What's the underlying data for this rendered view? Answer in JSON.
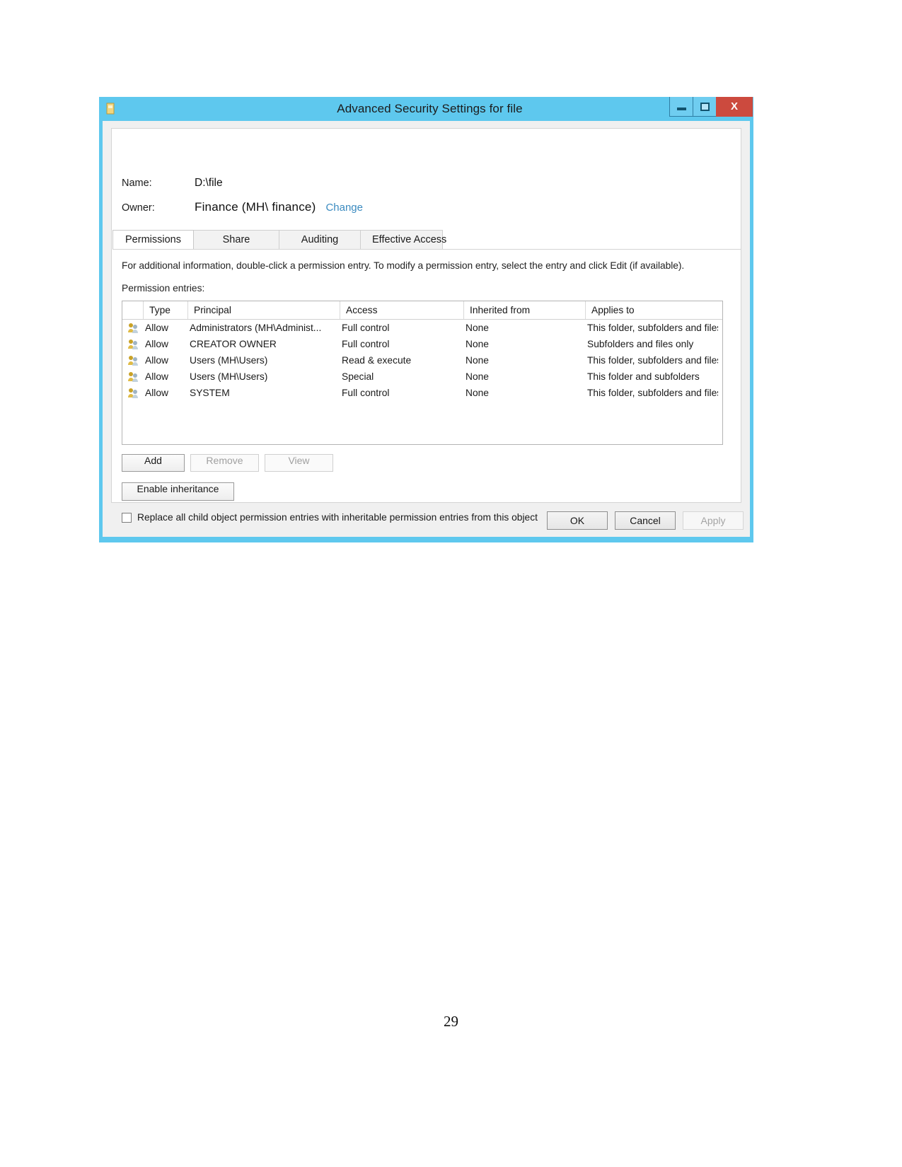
{
  "window": {
    "title": "Advanced Security Settings for file",
    "icon": "folder-security-icon",
    "minimize_label": "–",
    "maximize_label": "□",
    "close_label": "X",
    "titlebar_color": "#5ec8ee",
    "close_button_color": "#cc4a3e"
  },
  "header": {
    "name_label": "Name:",
    "name_value": "D:\\file",
    "owner_label": "Owner:",
    "owner_value": "Finance (MH\\ finance)",
    "change_link": "Change",
    "link_color": "#3b8bc0"
  },
  "tabs": [
    {
      "label": "Permissions",
      "selected": true
    },
    {
      "label": "Share",
      "selected": false
    },
    {
      "label": "Auditing",
      "selected": false
    },
    {
      "label": "Effective Access",
      "selected": false
    }
  ],
  "main": {
    "info_text": "For additional information, double-click a permission entry. To modify a permission entry, select the entry and click Edit (if available).",
    "entries_label": "Permission entries:"
  },
  "table": {
    "columns": [
      "",
      "Type",
      "Principal",
      "Access",
      "Inherited from",
      "Applies to"
    ],
    "rows": [
      {
        "icon": "users-group-icon",
        "type": "Allow",
        "principal": "Administrators (MH\\Administ...",
        "access": "Full control",
        "inherited_from": "None",
        "applies_to": "This folder, subfolders and files"
      },
      {
        "icon": "users-group-icon",
        "type": "Allow",
        "principal": "CREATOR OWNER",
        "access": "Full control",
        "inherited_from": "None",
        "applies_to": "Subfolders and files only"
      },
      {
        "icon": "users-group-icon",
        "type": "Allow",
        "principal": "Users (MH\\Users)",
        "access": "Read & execute",
        "inherited_from": "None",
        "applies_to": "This folder, subfolders and files"
      },
      {
        "icon": "users-group-icon",
        "type": "Allow",
        "principal": "Users (MH\\Users)",
        "access": "Special",
        "inherited_from": "None",
        "applies_to": "This folder and subfolders"
      },
      {
        "icon": "users-group-icon",
        "type": "Allow",
        "principal": "SYSTEM",
        "access": "Full control",
        "inherited_from": "None",
        "applies_to": "This folder, subfolders and files"
      }
    ]
  },
  "actions": {
    "add_label": "Add",
    "add_enabled": true,
    "remove_label": "Remove",
    "remove_enabled": false,
    "view_label": "View",
    "view_enabled": false,
    "inheritance_label": "Enable inheritance",
    "inheritance_enabled": true
  },
  "replace_option": {
    "label": "Replace all child object permission entries with inheritable permission entries from this object",
    "checked": false
  },
  "footer": {
    "ok_label": "OK",
    "cancel_label": "Cancel",
    "apply_label": "Apply",
    "apply_enabled": false
  },
  "document": {
    "page_number": "29"
  }
}
